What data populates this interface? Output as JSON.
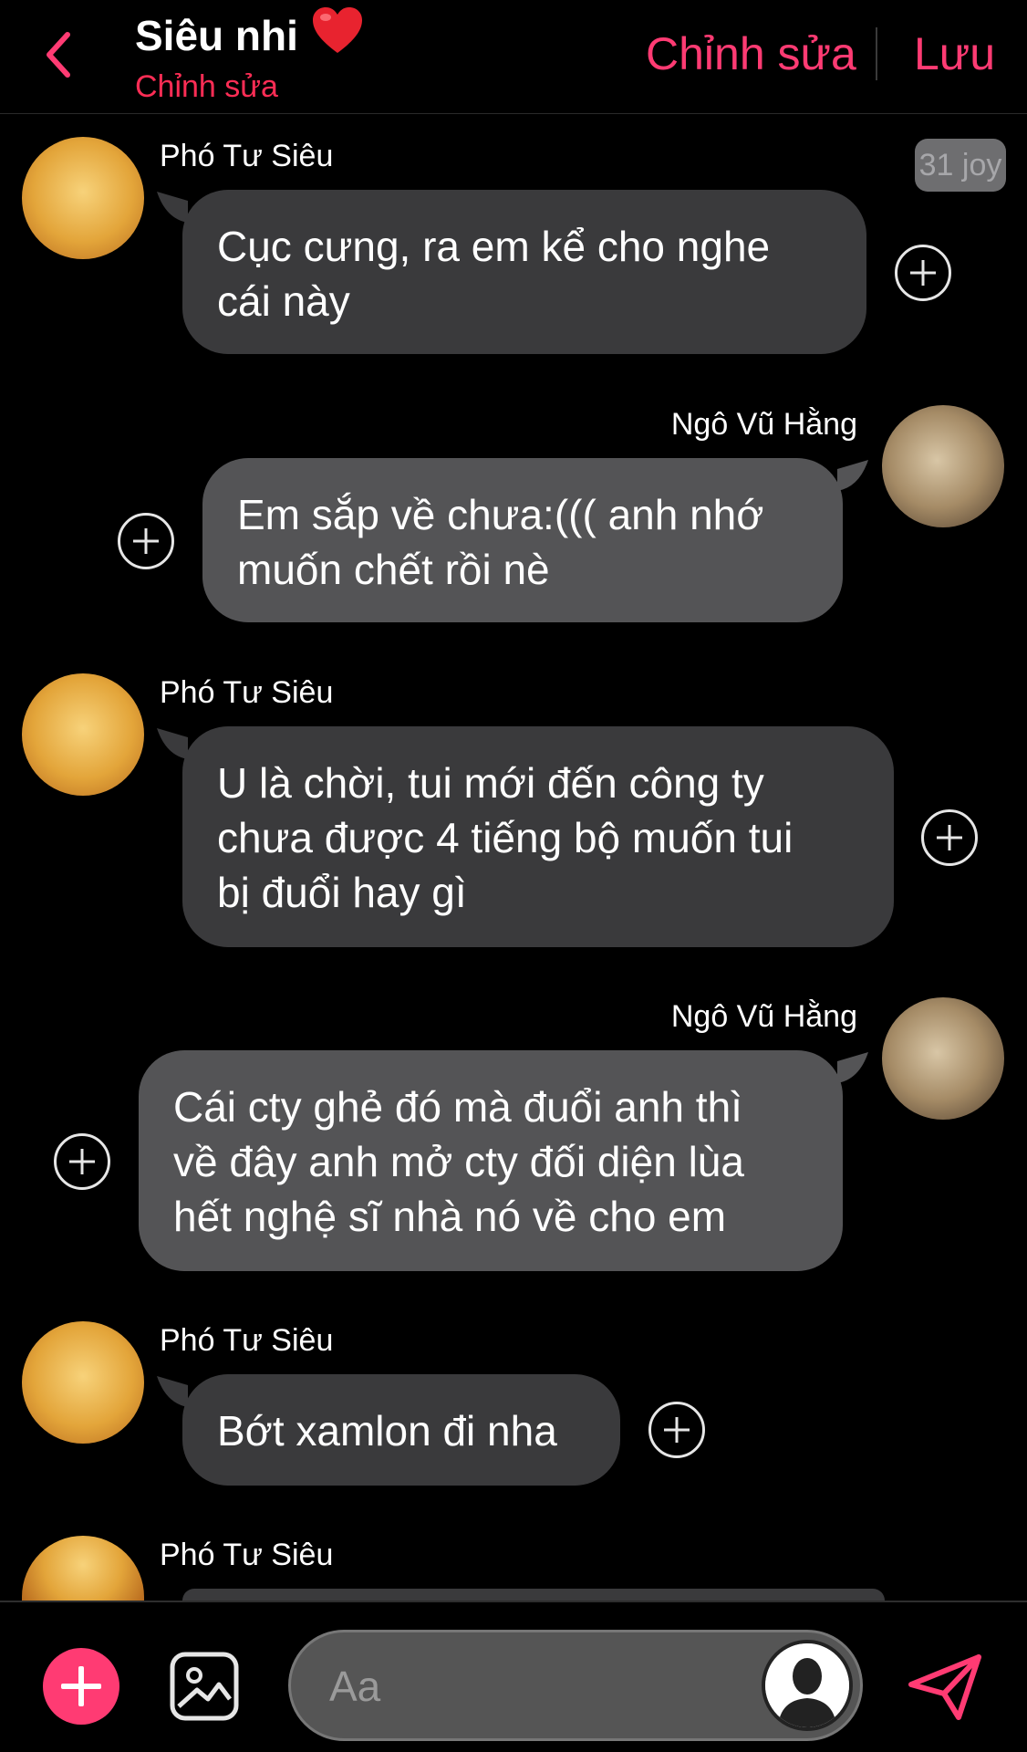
{
  "header": {
    "title": "Siêu nhi",
    "title_emoji": "❤️",
    "subtitle": "Chỉnh sửa",
    "edit_label": "Chỉnh sửa",
    "save_label": "Lưu"
  },
  "badge": "31 joy",
  "messages": [
    {
      "sender": "Phó Tư Siêu",
      "side": "left",
      "lines": [
        "Cục cưng, ra em kể cho nghe",
        "cái này"
      ]
    },
    {
      "sender": "Ngô Vũ Hằng",
      "side": "right",
      "lines": [
        "Em sắp về chưa:((( anh nhớ",
        "muốn chết rồi nè"
      ]
    },
    {
      "sender": "Phó Tư Siêu",
      "side": "left",
      "lines": [
        "U là chời, tui mới đến công ty",
        "chưa được 4 tiếng bộ muốn tui",
        "bị đuổi hay gì"
      ]
    },
    {
      "sender": "Ngô Vũ Hằng",
      "side": "right",
      "lines": [
        "Cái cty ghẻ đó mà đuổi anh thì",
        "về đây anh mở cty đối diện lùa",
        "hết nghệ sĩ nhà nó về cho em"
      ]
    },
    {
      "sender": "Phó Tư Siêu",
      "side": "left",
      "lines": [
        "Bớt xamlon đi nha"
      ]
    },
    {
      "sender": "Phó Tư Siêu",
      "side": "left",
      "lines": []
    }
  ],
  "composer": {
    "placeholder": "Aa"
  },
  "colors": {
    "accent": "#ff3b73",
    "bubble_left": "#3a3a3c",
    "bubble_right": "#545456"
  }
}
